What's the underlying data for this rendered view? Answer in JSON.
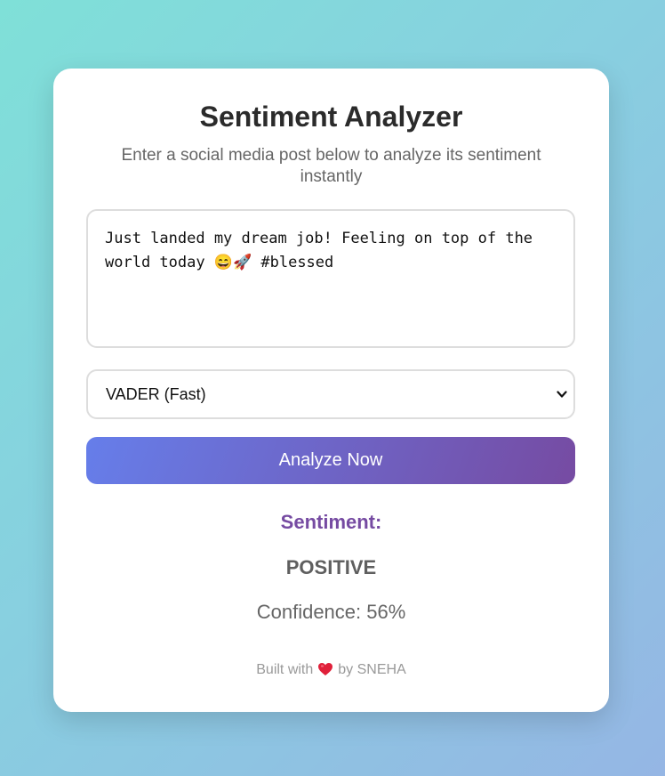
{
  "app": {
    "title": "Sentiment Analyzer",
    "subtitle": "Enter a social media post below to analyze its sentiment instantly"
  },
  "input": {
    "post_text": "Just landed my dream job! Feeling on top of the world today 😄🚀 #blessed"
  },
  "model_select": {
    "selected": "VADER (Fast)",
    "icon": "chevron-down-icon"
  },
  "analyze_button": {
    "label": "Analyze Now"
  },
  "result": {
    "sentiment_label": "Sentiment:",
    "sentiment_value": "POSITIVE",
    "confidence": "Confidence: 56%"
  },
  "footer": {
    "built_with": "Built with",
    "by": "by SNEHA",
    "icon": "heart-icon"
  },
  "colors": {
    "accent_start": "#667eea",
    "accent_end": "#764ba2",
    "heart": "#e0203a"
  }
}
